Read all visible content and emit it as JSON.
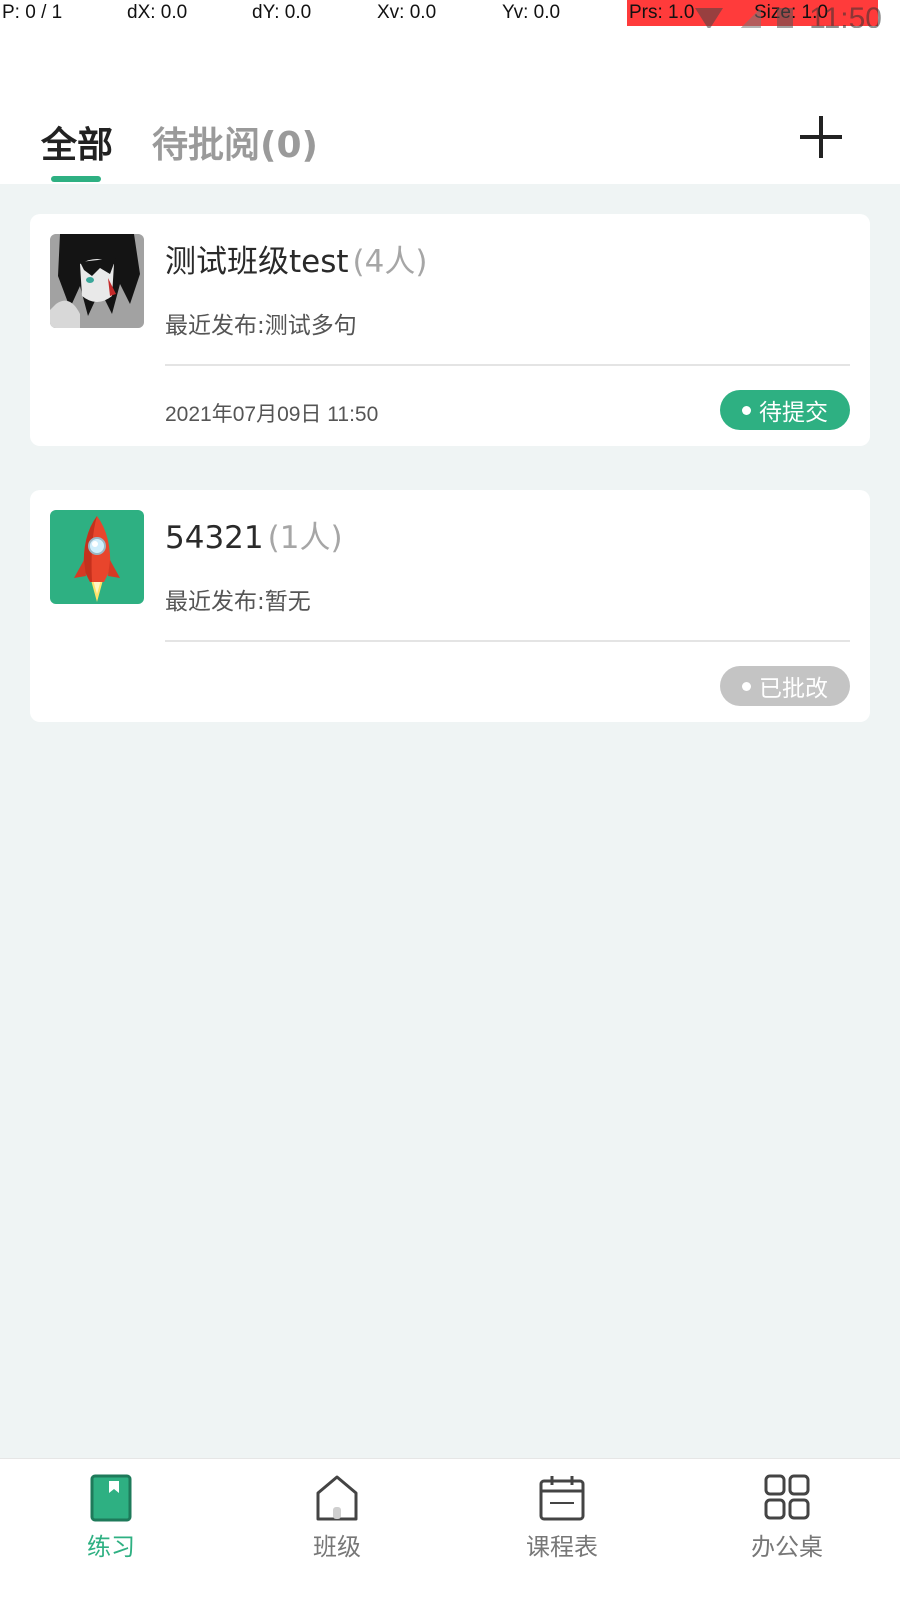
{
  "debug": {
    "p": "P: 0 / 1",
    "dx": "dX: 0.0",
    "dy": "dY: 0.0",
    "xv": "Xv: 0.0",
    "yv": "Yv: 0.0",
    "prs": "Prs: 1.0",
    "size": "Size: 1.0"
  },
  "status_bar": {
    "time": "11:50"
  },
  "header": {
    "tabs": [
      {
        "label": "全部",
        "active": true
      },
      {
        "label": "待批阅(0)",
        "active": false
      }
    ],
    "add_icon": "plus-icon"
  },
  "classes": [
    {
      "name": "测试班级test",
      "count": "(4人)",
      "recent": "最近发布:测试多句",
      "date": "2021年07月09日 11:50",
      "status": "待提交",
      "status_color": "#2eb082",
      "avatar": "anime-character-avatar"
    },
    {
      "name": "54321",
      "count": "(1人)",
      "recent": "最近发布:暂无",
      "date": "",
      "status": "已批改",
      "status_color": "#c4c4c4",
      "avatar": "rocket-avatar"
    }
  ],
  "bottom_nav": [
    {
      "label": "练习",
      "icon": "book-icon",
      "active": true
    },
    {
      "label": "班级",
      "icon": "home-icon",
      "active": false
    },
    {
      "label": "课程表",
      "icon": "calendar-icon",
      "active": false
    },
    {
      "label": "办公桌",
      "icon": "grid-icon",
      "active": false
    }
  ],
  "colors": {
    "accent": "#2eb082",
    "background": "#eff4f4",
    "inactive_badge": "#c4c4c4"
  }
}
